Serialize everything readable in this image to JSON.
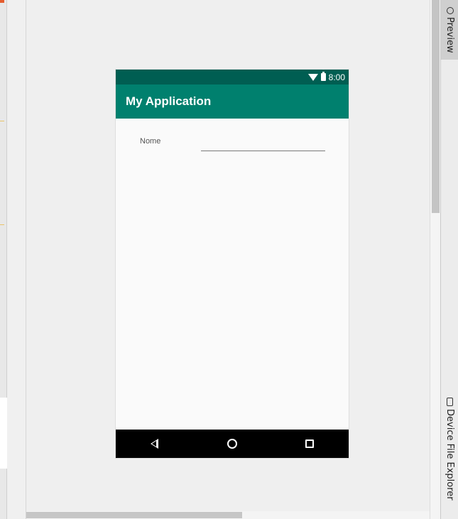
{
  "tool_window": {
    "preview_label": "Preview",
    "device_file_explorer_label": "Device File Explorer"
  },
  "phone": {
    "status_bar": {
      "time": "8:00",
      "icons": [
        "wifi-icon",
        "battery-icon"
      ]
    },
    "app_bar": {
      "title": "My Application"
    },
    "form": {
      "name_label": "Nome",
      "name_value": "",
      "name_placeholder": ""
    },
    "nav_bar": {
      "buttons": [
        "back-icon",
        "home-icon",
        "recents-icon"
      ]
    }
  },
  "colors": {
    "status_bar": "#005e52",
    "app_bar": "#00806e",
    "nav_bar": "#000000"
  }
}
